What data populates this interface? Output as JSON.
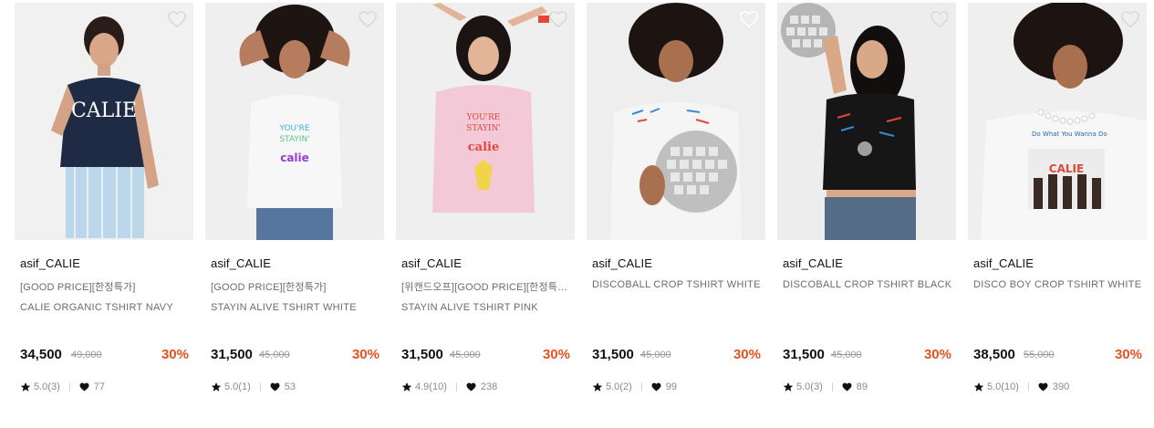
{
  "products": [
    {
      "brand": "asif_CALIE",
      "tagline": "[GOOD PRICE][한정특가]",
      "name": "CALIE ORGANIC TSHIRT NAVY",
      "price": "34,500",
      "original_price": "49,000",
      "discount": "30%",
      "rating": "5.0(3)",
      "likes": "77",
      "tshirt_color": "#1f2a44",
      "print_text": "CALIE"
    },
    {
      "brand": "asif_CALIE",
      "tagline": "[GOOD PRICE][한정특가]",
      "name": "STAYIN ALIVE TSHIRT WHITE",
      "price": "31,500",
      "original_price": "45,000",
      "discount": "30%",
      "rating": "5.0(1)",
      "likes": "53",
      "tshirt_color": "#f7f7f7",
      "print_text": "calie"
    },
    {
      "brand": "asif_CALIE",
      "tagline": "[위캔드오프][GOOD PRICE][한정특…",
      "name": "STAYIN ALIVE TSHIRT PINK",
      "price": "31,500",
      "original_price": "45,000",
      "discount": "30%",
      "rating": "4.9(10)",
      "likes": "238",
      "tshirt_color": "#f4c9d7",
      "print_text": "calie"
    },
    {
      "brand": "asif_CALIE",
      "tagline": "",
      "name": "DISCOBALL CROP TSHIRT WHITE",
      "price": "31,500",
      "original_price": "45,000",
      "discount": "30%",
      "rating": "5.0(2)",
      "likes": "99",
      "tshirt_color": "#f5f5f5",
      "print_text": ""
    },
    {
      "brand": "asif_CALIE",
      "tagline": "",
      "name": "DISCOBALL CROP TSHIRT BLACK",
      "price": "31,500",
      "original_price": "45,000",
      "discount": "30%",
      "rating": "5.0(3)",
      "likes": "89",
      "tshirt_color": "#161616",
      "print_text": ""
    },
    {
      "brand": "asif_CALIE",
      "tagline": "",
      "name": "DISCO BOY CROP TSHIRT WHITE",
      "price": "38,500",
      "original_price": "55,000",
      "discount": "30%",
      "rating": "5.0(10)",
      "likes": "390",
      "tshirt_color": "#f7f7f7",
      "print_text": "CALIE"
    }
  ],
  "icons": {
    "wishlist": "heart-outline-icon",
    "rating": "star-icon",
    "likes": "heart-filled-icon"
  },
  "colors": {
    "discount": "#e8501f",
    "text": "#111111",
    "muted": "#6b6b6b"
  }
}
